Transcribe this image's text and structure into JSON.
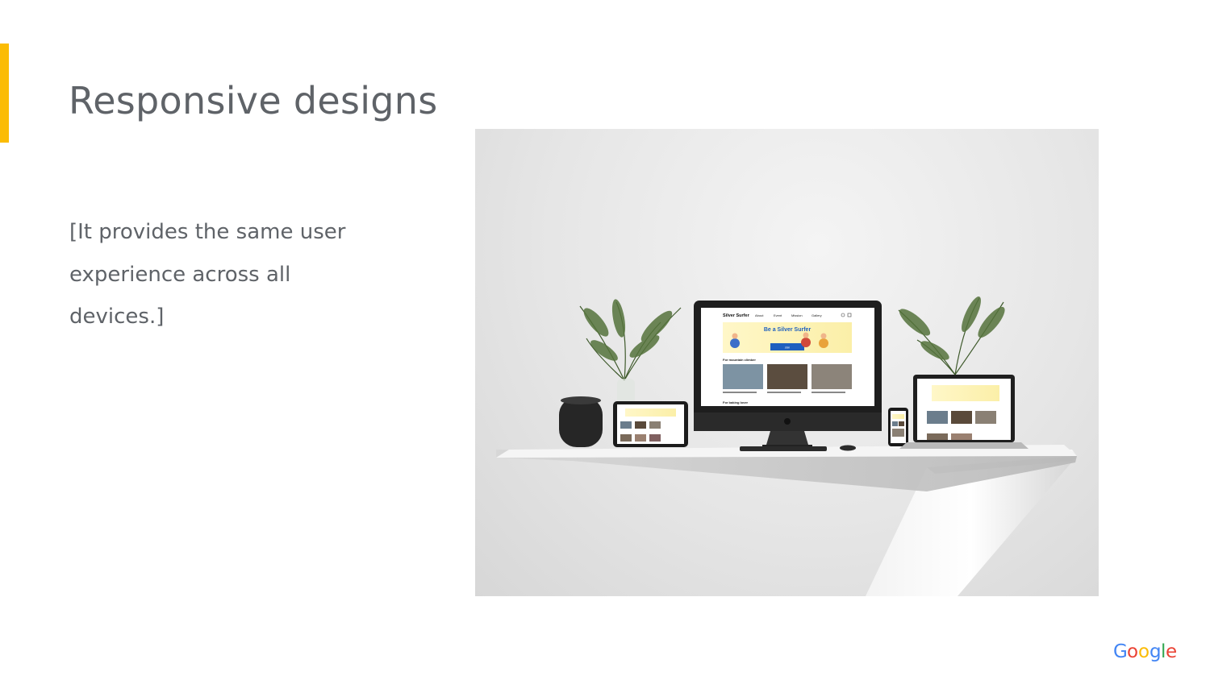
{
  "slide": {
    "title": "Responsive designs",
    "body": "[It provides the same user experience across all devices.]"
  },
  "photo": {
    "site_name": "Silver Surfer",
    "nav_items": [
      "About",
      "Event",
      "Mission",
      "Gallery"
    ],
    "hero_text": "Be a Silver Surfer",
    "hero_button": "Join",
    "section_1": "For mountain climber",
    "section_2": "For baking lover"
  },
  "brand": {
    "logo_text": "Google",
    "accent_color": "#fbbc04",
    "logo_colors": [
      "#4285f4",
      "#ea4335",
      "#fbbc04",
      "#4285f4",
      "#34a853",
      "#ea4335"
    ]
  }
}
